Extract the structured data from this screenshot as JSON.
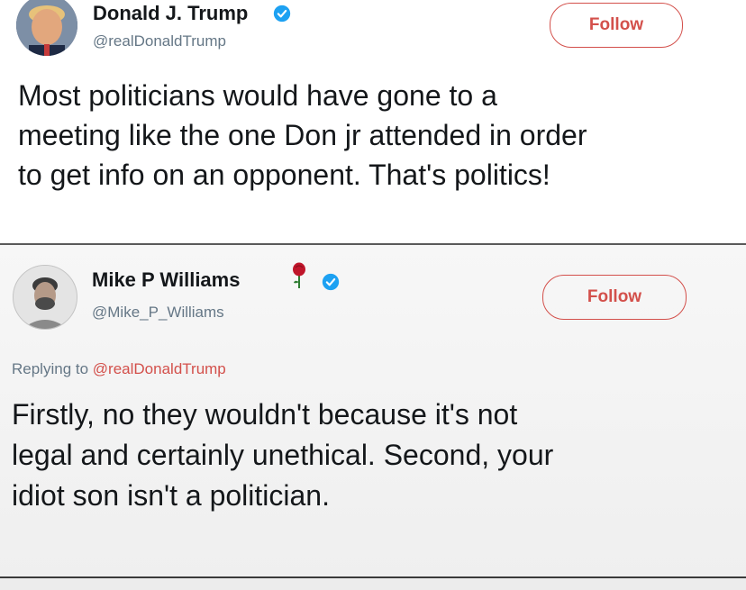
{
  "tweet1": {
    "name": "Donald J. Trump",
    "handle": "@realDonaldTrump",
    "follow_label": "Follow",
    "text_lines": [
      "Most politicians would have gone to a",
      "meeting like the one Don jr attended in order",
      "to get info on an opponent. That's politics!"
    ]
  },
  "tweet2": {
    "name": "Mike P Williams",
    "handle": "@Mike_P_Williams",
    "follow_label": "Follow",
    "replying_prefix": "Replying to",
    "replying_handle": "@realDonaldTrump",
    "text_lines": [
      "Firstly, no they wouldn't because it's not",
      "legal and certainly unethical. Second, your",
      "idiot son isn't a politician."
    ]
  },
  "colors": {
    "follow_accent": "#d3504b",
    "verified_blue": "#1da1f2",
    "handle_gray": "#657786",
    "rose_red": "#c0152a"
  },
  "icons": {
    "verified": "verified-badge-icon",
    "rose": "rose-icon"
  }
}
